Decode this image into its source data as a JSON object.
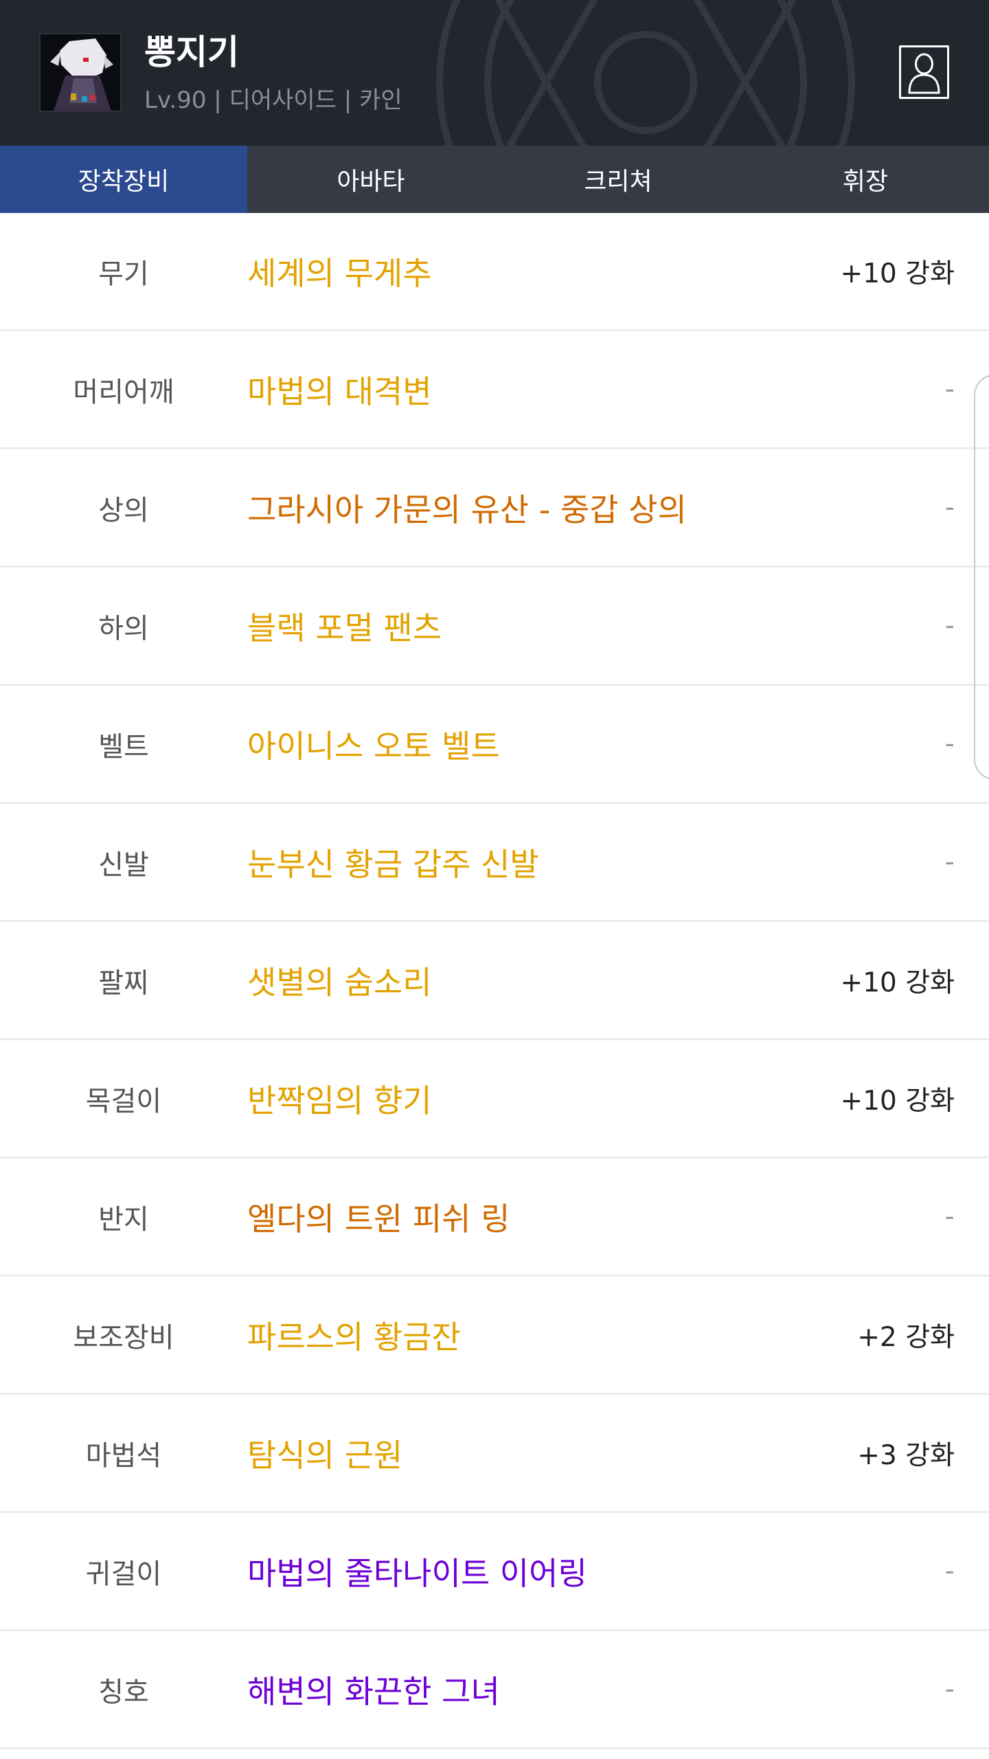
{
  "character": {
    "name": "뽕지기",
    "meta": "Lv.90 | 디어사이드 | 카인"
  },
  "icons": {
    "avatar": "character-portrait",
    "profile_button": "person-profile-icon"
  },
  "tabs": [
    {
      "label": "장착장비",
      "active": true
    },
    {
      "label": "아바타",
      "active": false
    },
    {
      "label": "크리쳐",
      "active": false
    },
    {
      "label": "휘장",
      "active": false
    }
  ],
  "colors": {
    "header_bg": "#22262d",
    "tab_bg": "#353a45",
    "tab_active_bg": "#2c4a8f",
    "rarity_unique": "#e3a200",
    "rarity_legendary": "#d06a00",
    "rarity_epic": "#6d00d6"
  },
  "equipment": [
    {
      "slot": "무기",
      "item": "세계의 무게추",
      "rarity": "unique",
      "color": "#e3a200",
      "upgrade": "+10 강화"
    },
    {
      "slot": "머리어깨",
      "item": "마법의 대격변",
      "rarity": "unique",
      "color": "#e3a200",
      "upgrade": "-"
    },
    {
      "slot": "상의",
      "item": "그라시아 가문의 유산 - 중갑 상의",
      "rarity": "legendary",
      "color": "#d06a00",
      "upgrade": "-"
    },
    {
      "slot": "하의",
      "item": "블랙 포멀 팬츠",
      "rarity": "unique",
      "color": "#e3a200",
      "upgrade": "-"
    },
    {
      "slot": "벨트",
      "item": "아이니스 오토 벨트",
      "rarity": "unique",
      "color": "#e3a200",
      "upgrade": "-"
    },
    {
      "slot": "신발",
      "item": "눈부신 황금 갑주 신발",
      "rarity": "unique",
      "color": "#e3a200",
      "upgrade": "-"
    },
    {
      "slot": "팔찌",
      "item": "샛별의 숨소리",
      "rarity": "unique",
      "color": "#e3a200",
      "upgrade": "+10 강화"
    },
    {
      "slot": "목걸이",
      "item": "반짝임의 향기",
      "rarity": "unique",
      "color": "#e3a200",
      "upgrade": "+10 강화"
    },
    {
      "slot": "반지",
      "item": "엘다의 트윈 피쉬 링",
      "rarity": "legendary",
      "color": "#d06a00",
      "upgrade": "-"
    },
    {
      "slot": "보조장비",
      "item": "파르스의 황금잔",
      "rarity": "unique",
      "color": "#e3a200",
      "upgrade": "+2 강화"
    },
    {
      "slot": "마법석",
      "item": "탐식의 근원",
      "rarity": "unique",
      "color": "#e3a200",
      "upgrade": "+3 강화"
    },
    {
      "slot": "귀걸이",
      "item": "마법의 줄타나이트 이어링",
      "rarity": "epic",
      "color": "#6d00d6",
      "upgrade": "-"
    },
    {
      "slot": "칭호",
      "item": "해변의 화끈한 그녀",
      "rarity": "epic",
      "color": "#6d00d6",
      "upgrade": "-"
    }
  ]
}
